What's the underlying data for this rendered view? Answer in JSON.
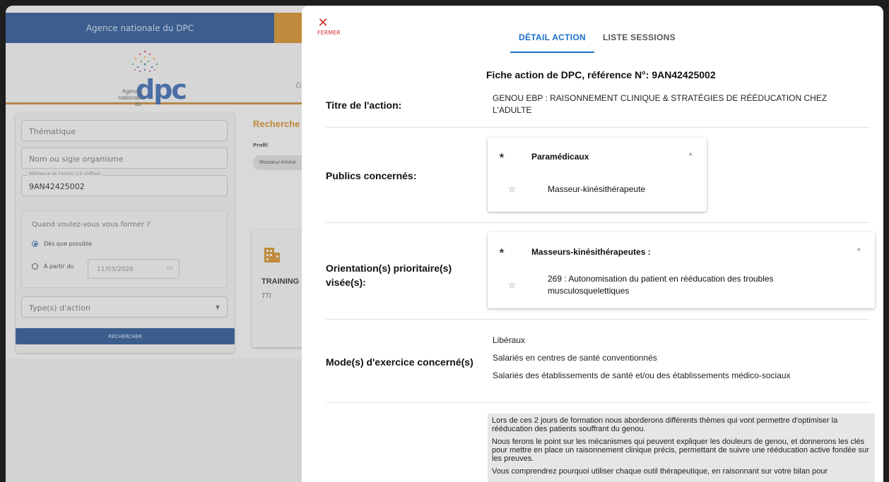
{
  "background": {
    "agency_banner": "Agence nationale du DPC",
    "logo_word": "dpc",
    "logo_sub_line1": "Agence",
    "logo_sub_line2": "nationale du",
    "filters": {
      "thematique_placeholder": "Thématique",
      "organisme_placeholder": "Nom ou sigle organisme",
      "reference_label": "Référence de l'action (11 chiffres)",
      "reference_value": "9AN42425002",
      "when_question": "Quand voulez-vous vous former ?",
      "option_asap": "Dès que possible",
      "option_from": "À partir du",
      "date_value": "11/03/2026",
      "type_placeholder": "Type(s) d'action",
      "search_button": "RECHERCHER"
    },
    "results": {
      "title": "Recherche",
      "profil_label": "Profil",
      "profil_chip": "Masseur-kinési",
      "card_name": "TRAINING",
      "card_sub": "TTI"
    }
  },
  "drawer": {
    "close_label": "FERMER",
    "tabs": [
      {
        "label": "DÉTAIL ACTION",
        "active": true
      },
      {
        "label": "LISTE SESSIONS",
        "active": false
      }
    ],
    "fiche_title": "Fiche action de DPC, référence N°: 9AN42425002",
    "titre": {
      "key": "Titre de l'action:",
      "line1": "GENOU EBP : RAISONNEMENT CLINIQUE & STRATÉGIES DE RÉÉDUCATION CHEZ",
      "line2": "L'ADULTE"
    },
    "publics": {
      "key": "Publics concernés:",
      "group": "Paramédicaux",
      "item": "Masseur-kinésithérapeute"
    },
    "orientation": {
      "key_line1": "Orientation(s) prioritaire(s)",
      "key_line2": "visée(s):",
      "group": "Masseurs-kinésithérapeutes :",
      "item_line1": "269 : Autonomisation du patient en rééducation des troubles",
      "item_line2": "musculosquelettiques"
    },
    "modes": {
      "key": "Mode(s) d'exercice concerné(s)",
      "items": [
        "Libéraux",
        "Salariés en centres de santé conventionnés",
        "Salariés des établissements de santé et/ou des établissements médico-sociaux"
      ]
    },
    "description": [
      "Lors de ces 2 jours de formation nous aborderons différents thèmes qui vont permettre d'optimiser la rééducation des patients souffrant du genou.",
      "Nous ferons le point sur les mécanismes qui peuvent expliquer les douleurs de genou, et donnerons les clés pour mettre en place un raisonnement clinique précis, permettant de suivre une rééducation active fondée sur les preuves.",
      "Vous comprendrez pourquoi utiliser chaque outil thérapeutique, en raisonnant sur votre bilan pour"
    ]
  }
}
